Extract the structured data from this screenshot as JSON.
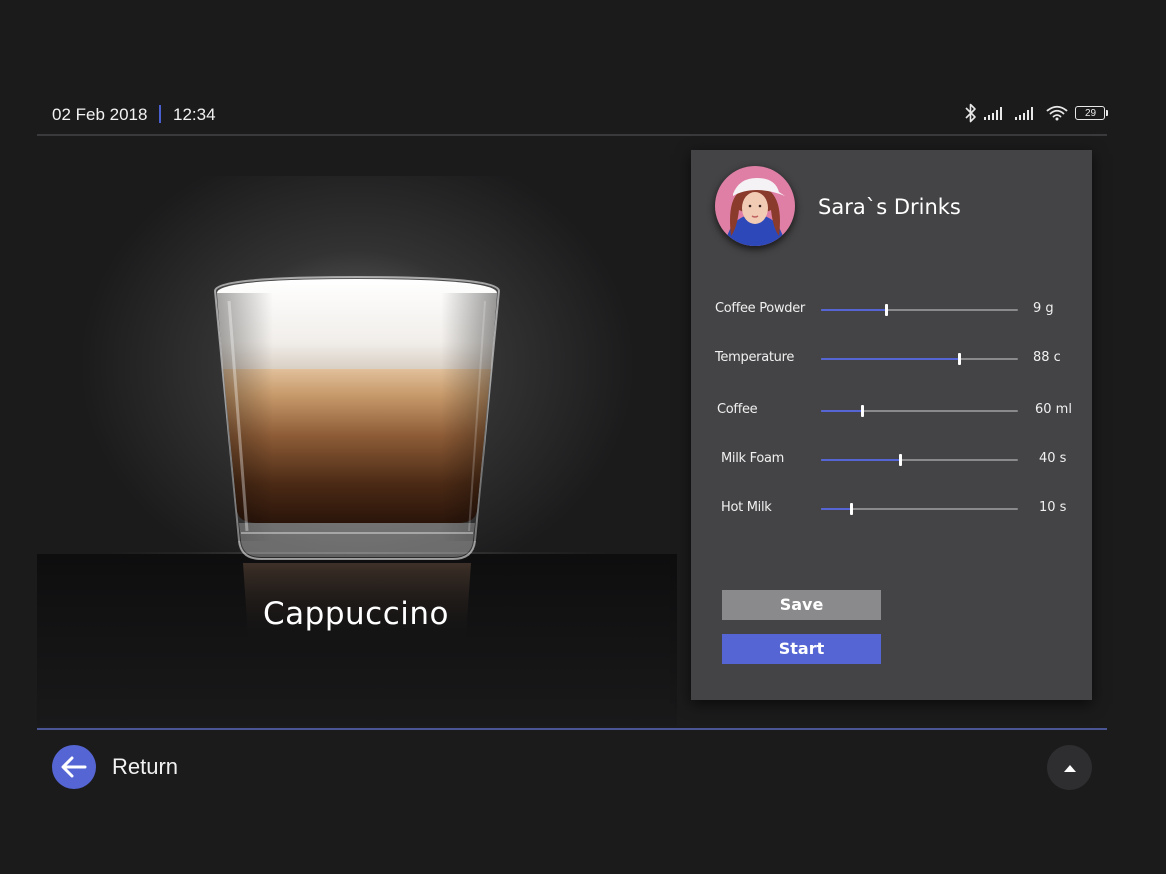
{
  "status_bar": {
    "date": "02 Feb 2018",
    "time": "12:34",
    "battery_level": "29",
    "accent_color": "#4a5fcf",
    "icons": [
      "bluetooth-icon",
      "signal-icon",
      "signal-icon",
      "wifi-icon",
      "battery-icon"
    ]
  },
  "drink": {
    "name": "Cappuccino",
    "image_icon": "cappuccino-glass-image"
  },
  "profile": {
    "name": "Sara`s Drinks",
    "avatar_icon": "user-avatar-photo"
  },
  "settings": [
    {
      "label": "Coffee Powder",
      "value": "9 g",
      "level": 0.33
    },
    {
      "label": "Temperature",
      "value": "88 c",
      "level": 0.7
    },
    {
      "label": "Coffee",
      "value": "60 ml",
      "level": 0.21
    },
    {
      "label": "Milk Foam",
      "value": "40 s",
      "level": 0.4
    },
    {
      "label": "Hot Milk",
      "value": "10 s",
      "level": 0.15
    }
  ],
  "actions": {
    "save_label": "Save",
    "start_label": "Start"
  },
  "navigation": {
    "return_label": "Return",
    "return_icon": "arrow-left-icon",
    "up_icon": "caret-up-icon"
  },
  "colors": {
    "background": "#1b1b1c",
    "panel": "#444446",
    "accent": "#5566d4",
    "save_button": "#8a8a8c"
  }
}
